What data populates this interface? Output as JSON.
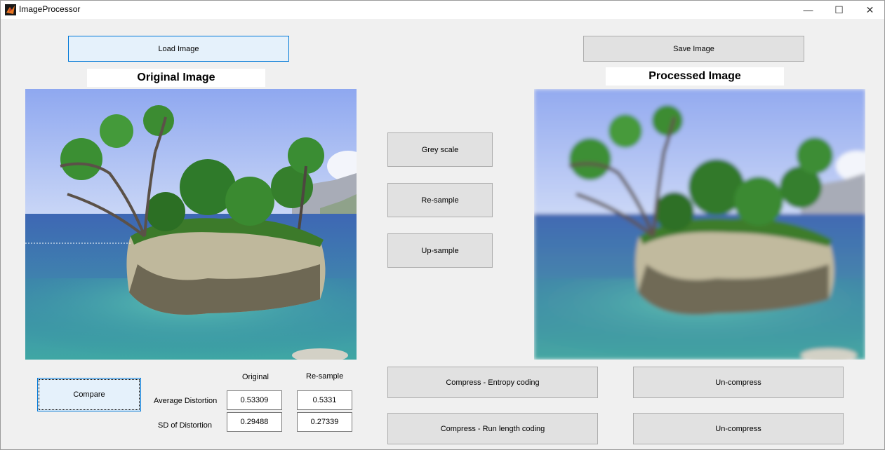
{
  "window": {
    "title": "ImageProcessor",
    "minimize": "—",
    "maximize": "☐",
    "close": "✕"
  },
  "buttons": {
    "load": "Load Image",
    "save": "Save Image",
    "grey": "Grey scale",
    "resample": "Re-sample",
    "upsample": "Up-sample",
    "compare": "Compare",
    "compress_entropy": "Compress - Entropy coding",
    "uncompress_1": "Un-compress",
    "compress_rle": "Compress - Run length coding",
    "uncompress_2": "Un-compress"
  },
  "headings": {
    "original": "Original Image",
    "processed": "Processed Image"
  },
  "stats": {
    "col_original": "Original",
    "col_resample": "Re-sample",
    "row_avg": "Average Distortion",
    "row_sd": "SD of Distortion",
    "avg_original": "0.53309",
    "avg_resample": "0.5331",
    "sd_original": "0.29488",
    "sd_resample": "0.27339"
  }
}
